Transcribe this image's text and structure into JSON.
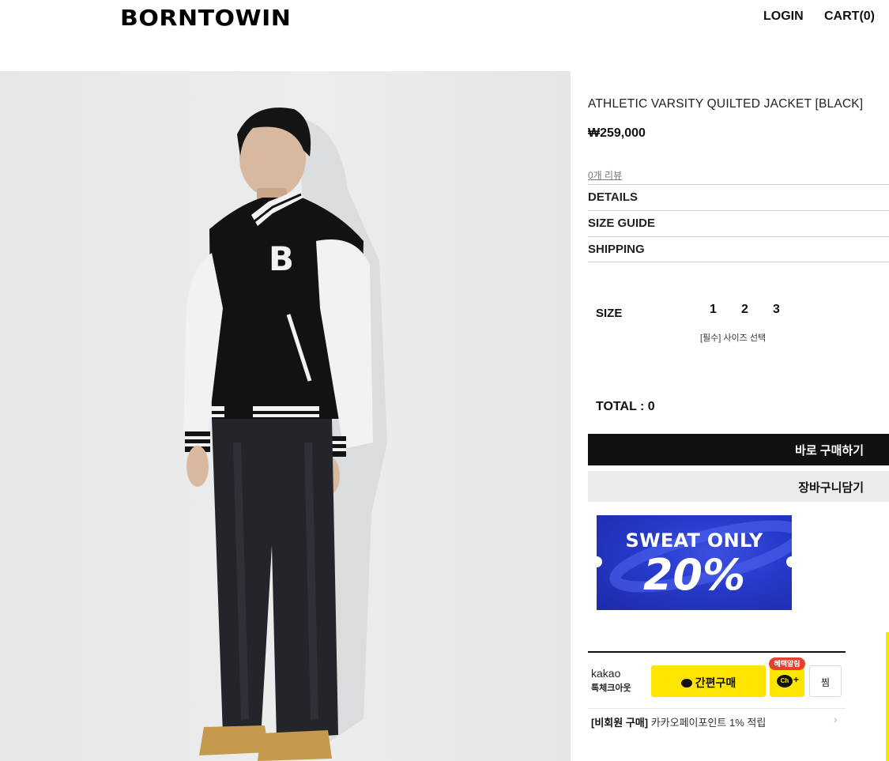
{
  "header": {
    "logo": "BORNTOWIN",
    "login": "LOGIN",
    "cart": "CART(0)"
  },
  "product": {
    "image_alt": "model wearing black varsity jacket with white sleeves and B patch, dark wide jeans and tan boots",
    "title": "ATHLETIC VARSITY QUILTED JACKET [BLACK]",
    "price": "₩259,000",
    "reviews": "0개 리뷰",
    "info_rows": [
      "DETAILS",
      "SIZE GUIDE",
      "SHIPPING"
    ]
  },
  "options": {
    "size_label": "SIZE",
    "sizes": [
      "1",
      "2",
      "3"
    ],
    "size_hint": "[필수] 사이즈 선택"
  },
  "total": "TOTAL : 0",
  "actions": {
    "buy_now": "바로 구매하기",
    "add_to_cart": "장바구니담기"
  },
  "banner": {
    "line1": "SWEAT ONLY",
    "line2": "20%",
    "colors": {
      "background": "#2639c9",
      "text": "#ffffff"
    }
  },
  "kakao": {
    "brand": "kakao",
    "sub": "톡체크아웃",
    "pay_button": "간편구매",
    "channel_badge": "혜택알림",
    "channel_icon": "Ch",
    "wish_button": "찜",
    "guest_tag": "[비회원 구매]",
    "guest_text": " 카카오페이포인트 1% 적립",
    "chevron_icon": "chevron-right-icon",
    "colors": {
      "yellow": "#fee500",
      "badge": "#e8402f"
    }
  }
}
